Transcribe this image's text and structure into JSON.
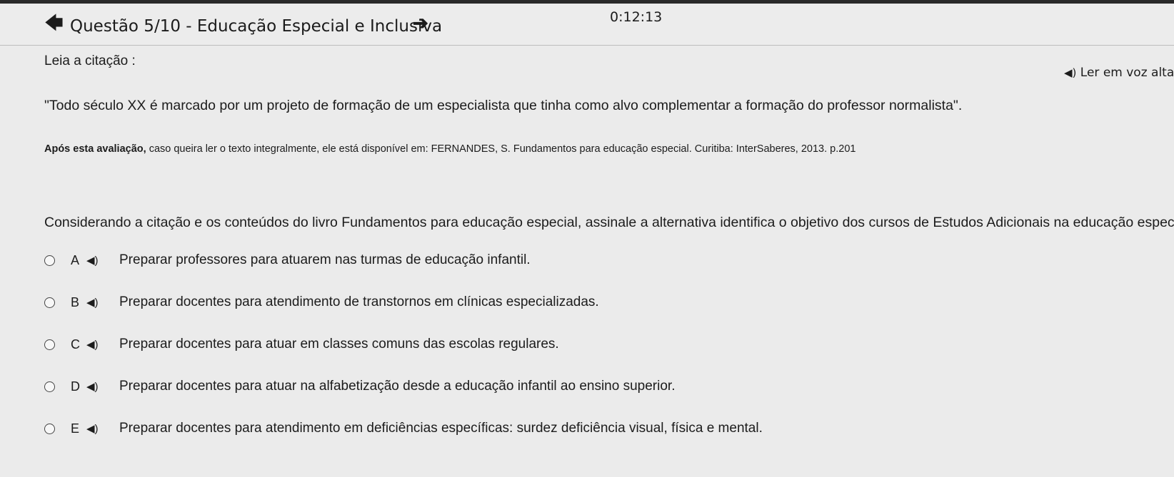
{
  "header": {
    "title": "Questão 5/10 - Educação Especial e Inclusiva",
    "prev_icon": "arrow-left-icon",
    "next_icon": "arrow-right-icon",
    "timer": "0:12:13"
  },
  "prompt": {
    "label": "Leia a citação :",
    "read_aloud_label": "Ler em voz alta",
    "quote": "\"Todo século XX é marcado por um projeto de formação de um especialista que tinha como alvo complementar a formação do professor normalista\".",
    "source_bold": "Após esta avaliação,",
    "source_text": " caso queira ler o texto integralmente, ele está disponível em: FERNANDES, S. Fundamentos para educação especial. Curitiba: InterSaberes, 2013. p.201"
  },
  "question": "Considerando a citação e os conteúdos do livro Fundamentos para educação especial, assinale a alternativa identifica o objetivo dos cursos de Estudos Adicionais na educação especial:",
  "options": [
    {
      "letter": "A",
      "text": "Preparar professores para atuarem nas turmas de educação infantil."
    },
    {
      "letter": "B",
      "text": "Preparar docentes para atendimento de transtornos em clínicas especializadas."
    },
    {
      "letter": "C",
      "text": "Preparar docentes para atuar em classes comuns das escolas regulares."
    },
    {
      "letter": "D",
      "text": "Preparar docentes para atuar na  alfabetização desde a educação infantil ao ensino superior."
    },
    {
      "letter": "E",
      "text": "Preparar docentes para atendimento em deficiências específicas: surdez deficiência visual, física e mental."
    }
  ],
  "icons": {
    "speaker": "speaker-icon",
    "radio": "radio-button"
  },
  "colors": {
    "background": "#ebebeb",
    "text": "#1c1c1c",
    "divider": "#bdbdbd"
  }
}
